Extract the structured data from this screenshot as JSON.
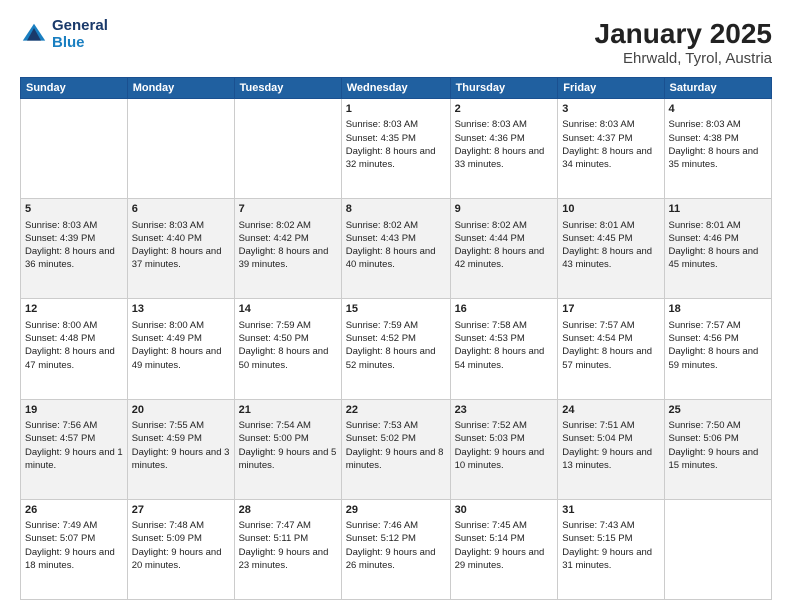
{
  "logo": {
    "general": "General",
    "blue": "Blue"
  },
  "title": "January 2025",
  "subtitle": "Ehrwald, Tyrol, Austria",
  "days": [
    "Sunday",
    "Monday",
    "Tuesday",
    "Wednesday",
    "Thursday",
    "Friday",
    "Saturday"
  ],
  "weeks": [
    [
      {
        "day": "",
        "content": ""
      },
      {
        "day": "",
        "content": ""
      },
      {
        "day": "",
        "content": ""
      },
      {
        "day": "1",
        "content": "Sunrise: 8:03 AM\nSunset: 4:35 PM\nDaylight: 8 hours and 32 minutes."
      },
      {
        "day": "2",
        "content": "Sunrise: 8:03 AM\nSunset: 4:36 PM\nDaylight: 8 hours and 33 minutes."
      },
      {
        "day": "3",
        "content": "Sunrise: 8:03 AM\nSunset: 4:37 PM\nDaylight: 8 hours and 34 minutes."
      },
      {
        "day": "4",
        "content": "Sunrise: 8:03 AM\nSunset: 4:38 PM\nDaylight: 8 hours and 35 minutes."
      }
    ],
    [
      {
        "day": "5",
        "content": "Sunrise: 8:03 AM\nSunset: 4:39 PM\nDaylight: 8 hours and 36 minutes."
      },
      {
        "day": "6",
        "content": "Sunrise: 8:03 AM\nSunset: 4:40 PM\nDaylight: 8 hours and 37 minutes."
      },
      {
        "day": "7",
        "content": "Sunrise: 8:02 AM\nSunset: 4:42 PM\nDaylight: 8 hours and 39 minutes."
      },
      {
        "day": "8",
        "content": "Sunrise: 8:02 AM\nSunset: 4:43 PM\nDaylight: 8 hours and 40 minutes."
      },
      {
        "day": "9",
        "content": "Sunrise: 8:02 AM\nSunset: 4:44 PM\nDaylight: 8 hours and 42 minutes."
      },
      {
        "day": "10",
        "content": "Sunrise: 8:01 AM\nSunset: 4:45 PM\nDaylight: 8 hours and 43 minutes."
      },
      {
        "day": "11",
        "content": "Sunrise: 8:01 AM\nSunset: 4:46 PM\nDaylight: 8 hours and 45 minutes."
      }
    ],
    [
      {
        "day": "12",
        "content": "Sunrise: 8:00 AM\nSunset: 4:48 PM\nDaylight: 8 hours and 47 minutes."
      },
      {
        "day": "13",
        "content": "Sunrise: 8:00 AM\nSunset: 4:49 PM\nDaylight: 8 hours and 49 minutes."
      },
      {
        "day": "14",
        "content": "Sunrise: 7:59 AM\nSunset: 4:50 PM\nDaylight: 8 hours and 50 minutes."
      },
      {
        "day": "15",
        "content": "Sunrise: 7:59 AM\nSunset: 4:52 PM\nDaylight: 8 hours and 52 minutes."
      },
      {
        "day": "16",
        "content": "Sunrise: 7:58 AM\nSunset: 4:53 PM\nDaylight: 8 hours and 54 minutes."
      },
      {
        "day": "17",
        "content": "Sunrise: 7:57 AM\nSunset: 4:54 PM\nDaylight: 8 hours and 57 minutes."
      },
      {
        "day": "18",
        "content": "Sunrise: 7:57 AM\nSunset: 4:56 PM\nDaylight: 8 hours and 59 minutes."
      }
    ],
    [
      {
        "day": "19",
        "content": "Sunrise: 7:56 AM\nSunset: 4:57 PM\nDaylight: 9 hours and 1 minute."
      },
      {
        "day": "20",
        "content": "Sunrise: 7:55 AM\nSunset: 4:59 PM\nDaylight: 9 hours and 3 minutes."
      },
      {
        "day": "21",
        "content": "Sunrise: 7:54 AM\nSunset: 5:00 PM\nDaylight: 9 hours and 5 minutes."
      },
      {
        "day": "22",
        "content": "Sunrise: 7:53 AM\nSunset: 5:02 PM\nDaylight: 9 hours and 8 minutes."
      },
      {
        "day": "23",
        "content": "Sunrise: 7:52 AM\nSunset: 5:03 PM\nDaylight: 9 hours and 10 minutes."
      },
      {
        "day": "24",
        "content": "Sunrise: 7:51 AM\nSunset: 5:04 PM\nDaylight: 9 hours and 13 minutes."
      },
      {
        "day": "25",
        "content": "Sunrise: 7:50 AM\nSunset: 5:06 PM\nDaylight: 9 hours and 15 minutes."
      }
    ],
    [
      {
        "day": "26",
        "content": "Sunrise: 7:49 AM\nSunset: 5:07 PM\nDaylight: 9 hours and 18 minutes."
      },
      {
        "day": "27",
        "content": "Sunrise: 7:48 AM\nSunset: 5:09 PM\nDaylight: 9 hours and 20 minutes."
      },
      {
        "day": "28",
        "content": "Sunrise: 7:47 AM\nSunset: 5:11 PM\nDaylight: 9 hours and 23 minutes."
      },
      {
        "day": "29",
        "content": "Sunrise: 7:46 AM\nSunset: 5:12 PM\nDaylight: 9 hours and 26 minutes."
      },
      {
        "day": "30",
        "content": "Sunrise: 7:45 AM\nSunset: 5:14 PM\nDaylight: 9 hours and 29 minutes."
      },
      {
        "day": "31",
        "content": "Sunrise: 7:43 AM\nSunset: 5:15 PM\nDaylight: 9 hours and 31 minutes."
      },
      {
        "day": "",
        "content": ""
      }
    ]
  ]
}
